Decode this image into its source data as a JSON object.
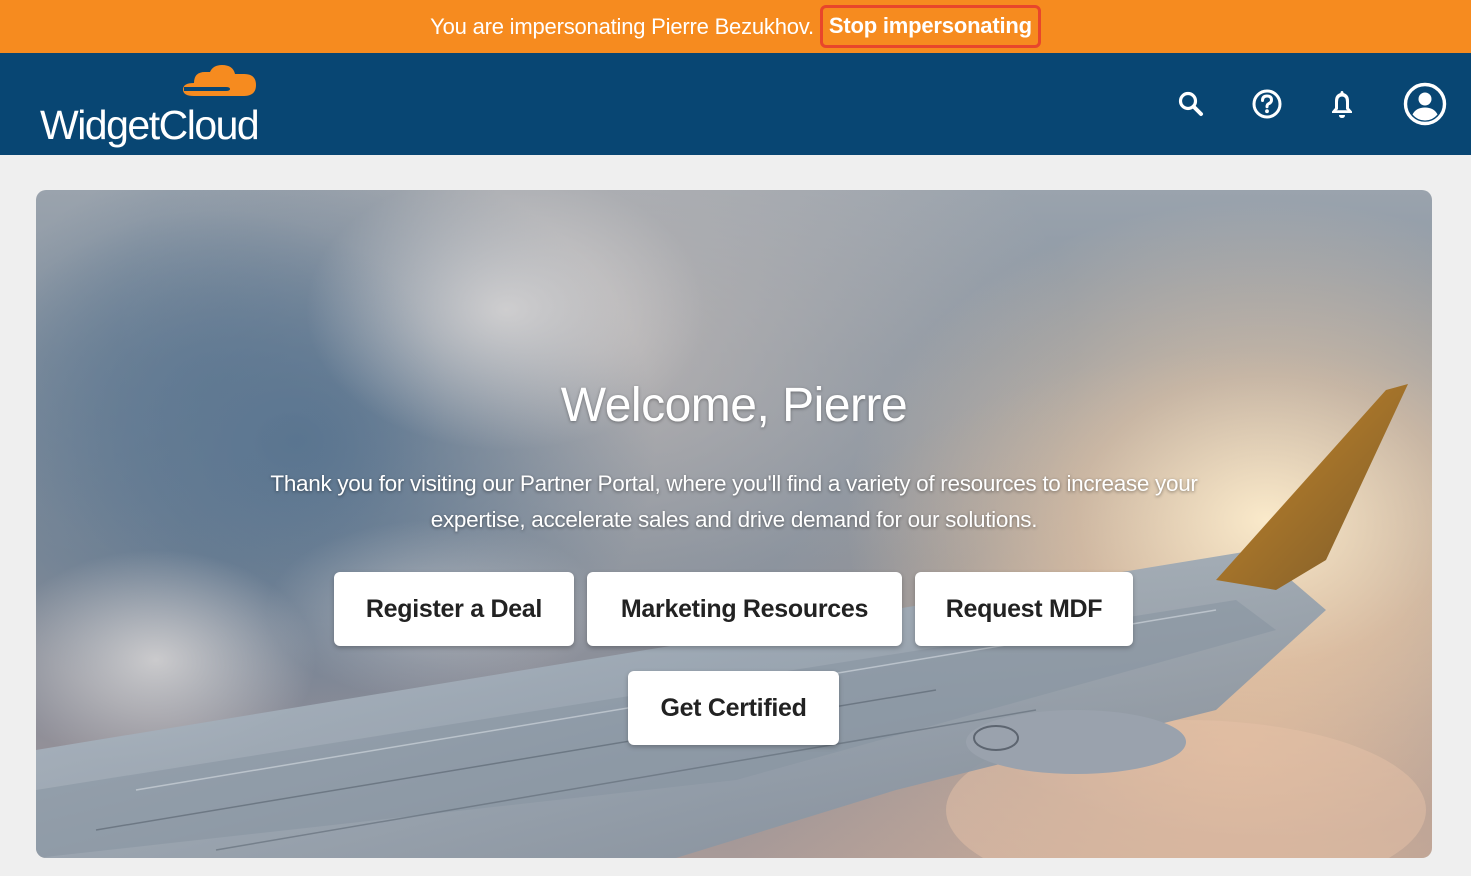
{
  "impersonation_bar": {
    "message": "You are impersonating Pierre Bezukhov.",
    "stop_label": "Stop impersonating",
    "background_color": "#f68b1f",
    "highlight_color": "#e8462b"
  },
  "header": {
    "logo_text": "WidgetCloud",
    "background_color": "#084673",
    "logo_accent_color": "#f68b1f",
    "icons": [
      "search-icon",
      "help-icon",
      "bell-icon",
      "user-account-icon"
    ]
  },
  "hero": {
    "title": "Welcome, Pierre",
    "intro": "Thank you for visiting our Partner Portal, where you'll find a variety of resources to increase your expertise, accelerate sales and drive demand for our solutions.",
    "buttons": [
      {
        "label": "Register a Deal"
      },
      {
        "label": "Marketing Resources"
      },
      {
        "label": "Request MDF"
      },
      {
        "label": "Get Certified"
      }
    ]
  }
}
